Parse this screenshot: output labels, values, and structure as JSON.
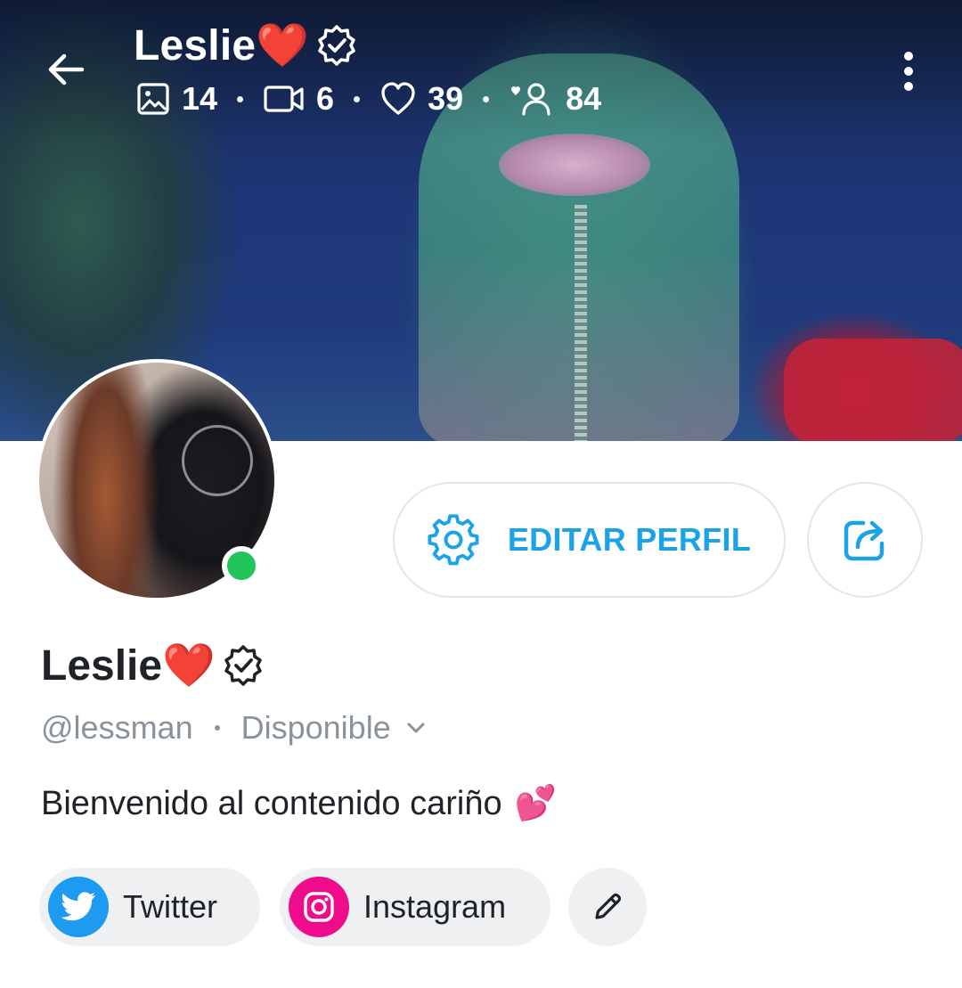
{
  "header": {
    "title": "Leslie❤️",
    "stats": {
      "images": "14",
      "videos": "6",
      "likes": "39",
      "fans": "84"
    }
  },
  "profile": {
    "name": "Leslie❤️",
    "handle": "@lessman",
    "status": "Disponible",
    "bio": "Bienvenido al contenido cariño",
    "bio_emoji": "💕",
    "online": true
  },
  "actions": {
    "edit_label": "EDITAR PERFIL"
  },
  "social_links": [
    {
      "label": "Twitter",
      "icon": "twitter-icon",
      "color": "#1d9bf0"
    },
    {
      "label": "Instagram",
      "icon": "instagram-icon",
      "color": "#ee0c8c"
    }
  ],
  "colors": {
    "accent": "#1aa3e6",
    "online": "#21c55a",
    "muted_text": "#8a939c"
  }
}
